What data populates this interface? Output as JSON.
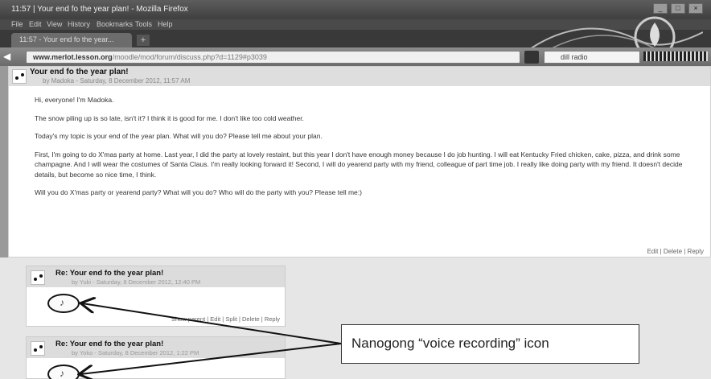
{
  "window": {
    "title": "11:57 | Your end fo the year plan! - Mozilla Firefox",
    "controls": [
      "_",
      "□",
      "×"
    ]
  },
  "menu": [
    "File",
    "Edit",
    "View",
    "History",
    "Bookmarks",
    "Tools",
    "Help"
  ],
  "tab": {
    "label": "11:57 - Your end fo the year...",
    "add": "+"
  },
  "nav": {
    "back_icon": "back-arrow-icon",
    "url_host": "www.merlot.lesson.org",
    "url_path": "/moodle/mod/forum/discuss.php?d=1129#p3039",
    "search_value": "dill radio"
  },
  "post": {
    "title": "Your end fo the year plan!",
    "meta": "by Madoka - Saturday, 8 December 2012, 11:57 AM",
    "paragraphs": [
      "Hi, everyone! I'm Madoka.",
      "The snow piling up is so late, isn't it? I think it is good for me. I don't like too cold weather.",
      "Today's my topic is your end of the year plan. What will you do? Please tell me about your plan.",
      "First, I'm going to do X'mas party at home. Last year, I did the party at lovely restaint, but this year I don't have enough money because I do job hunting. I will eat Kentucky Fried chicken, cake, pizza, and drink some champagne. And I will wear the costumes of Santa Claus. I'm really looking forward it! Second, I will do yearend party with my friend, colleague of part time job. I really like doing party with my friend. It doesn't decide details, but become so nice time, I think.",
      "Will you do X'mas party or yearend party? What will you do? Who will do the party with you? Please tell me:)"
    ],
    "actions": "Edit | Delete | Reply"
  },
  "replies": [
    {
      "title": "Re: Your end fo the year plan!",
      "meta": "by Yuki - Saturday, 8 December 2012, 12:40 PM",
      "actions": "Show parent | Edit | Split | Delete | Reply"
    },
    {
      "title": "Re: Your end fo the year plan!",
      "meta": "by Yoko - Saturday, 8 December 2012, 1:22 PM",
      "actions": ""
    }
  ],
  "callout": {
    "text": "Nanogong “voice recording” icon"
  },
  "colors": {
    "chrome_dark": "#3f3f3f",
    "page_bg": "#e6e6e6",
    "header_bg": "#dedede",
    "annotation": "#111111"
  }
}
